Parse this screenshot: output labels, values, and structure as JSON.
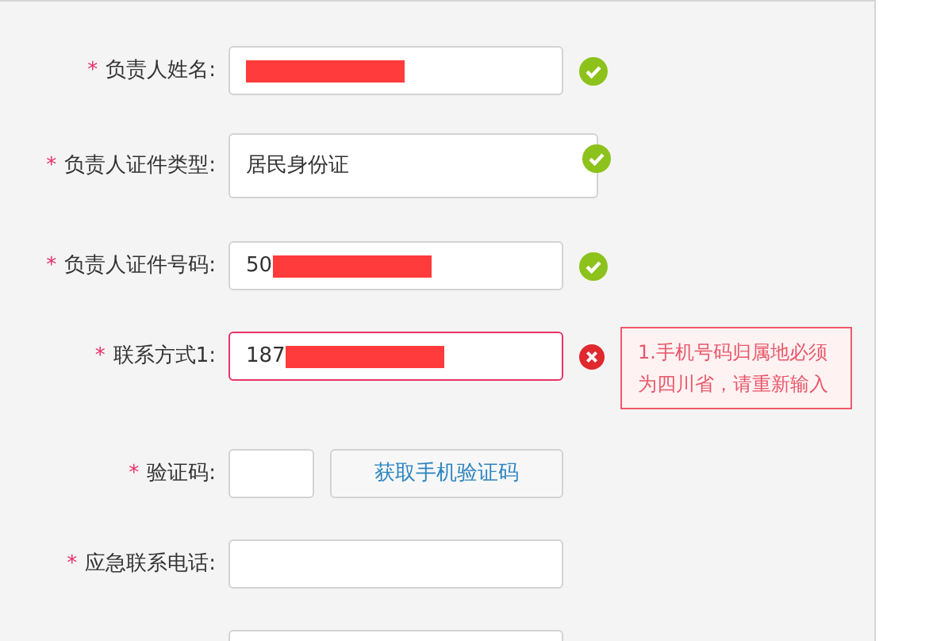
{
  "form": {
    "rows": [
      {
        "kind": "input",
        "required_mark": "*",
        "label": "负责人姓名:",
        "value": "",
        "redacted": true,
        "valid": true
      },
      {
        "kind": "select",
        "required_mark": "*",
        "label": "负责人证件类型:",
        "value": "居民身份证",
        "valid": true
      },
      {
        "kind": "input",
        "required_mark": "*",
        "label": "负责人证件号码:",
        "value": "50",
        "redacted": true,
        "valid": true
      },
      {
        "kind": "input",
        "required_mark": "*",
        "label": "联系方式1:",
        "value": "187",
        "redacted": true,
        "valid": false,
        "error_message": "1.手机号码归属地必须为四川省，请重新输入"
      },
      {
        "kind": "code",
        "required_mark": "*",
        "label": "验证码:",
        "value": "",
        "button": "获取手机验证码"
      },
      {
        "kind": "input",
        "required_mark": "*",
        "label": "应急联系电话:",
        "value": ""
      },
      {
        "kind": "input",
        "value": ""
      }
    ]
  }
}
